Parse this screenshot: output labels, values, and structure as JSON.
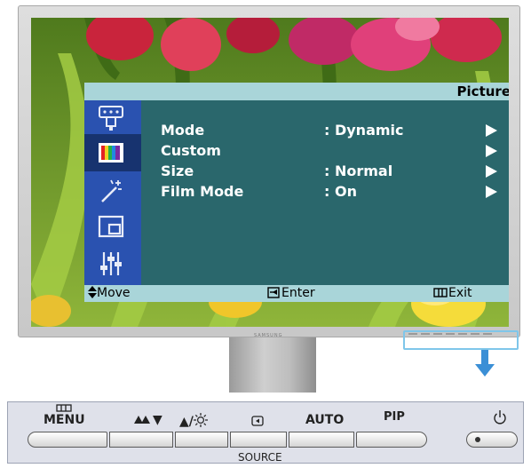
{
  "osd": {
    "title": "Picture",
    "side_icons": [
      "input-icon",
      "picture-icon",
      "magic-icon",
      "pip-icon",
      "setup-icon"
    ],
    "selected_icon": "picture-icon",
    "rows": [
      {
        "name": "Mode",
        "value": ": Dynamic",
        "arrow": true
      },
      {
        "name": "Custom",
        "value": "",
        "arrow": true
      },
      {
        "name": "Size",
        "value": ": Normal",
        "arrow": true
      },
      {
        "name": "Film Mode",
        "value": ": On",
        "arrow": true
      }
    ],
    "footer": {
      "move": "Move",
      "enter": "Enter",
      "exit": "Exit"
    }
  },
  "monitor": {
    "brand": "SAMSUNG"
  },
  "controls": {
    "menu": "MENU",
    "down": "▼",
    "brightness": "▲/",
    "auto": "AUTO",
    "pip": "PIP",
    "source": "SOURCE"
  },
  "colors": {
    "osd_panel": "#2a676c",
    "osd_sidebar": "#2a52b0",
    "osd_bars": "#a9d5d9",
    "highlight": "#7fc6ea",
    "arrow": "#3b8fd6"
  }
}
